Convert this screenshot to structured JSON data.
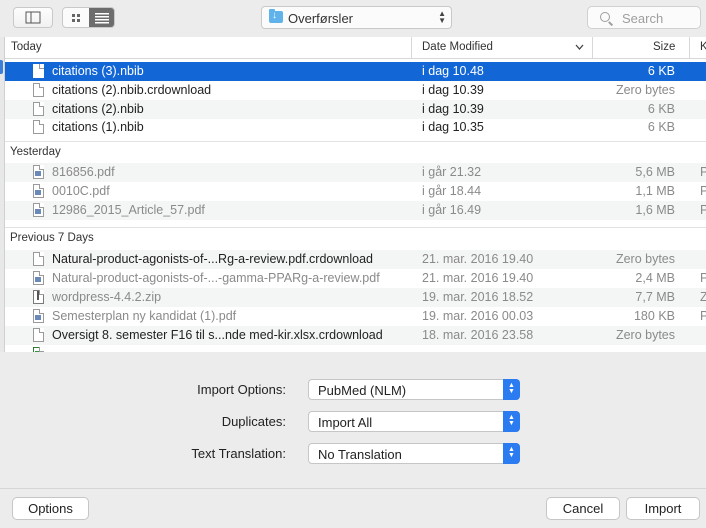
{
  "toolbar": {
    "location": "Overførsler",
    "search_placeholder": "Search"
  },
  "columns": {
    "name": "Today",
    "date": "Date Modified",
    "size": "Size",
    "kind": "K"
  },
  "groups": {
    "yesterday": "Yesterday",
    "previous": "Previous 7 Days"
  },
  "files": {
    "today": [
      {
        "name": "citations (3).nbib",
        "date": "i dag 10.48",
        "size": "6 KB"
      },
      {
        "name": "citations (2).nbib.crdownload",
        "date": "i dag 10.39",
        "size": "Zero bytes"
      },
      {
        "name": "citations (2).nbib",
        "date": "i dag 10.39",
        "size": "6 KB"
      },
      {
        "name": "citations (1).nbib",
        "date": "i dag 10.35",
        "size": "6 KB"
      }
    ],
    "yesterday": [
      {
        "name": "816856.pdf",
        "date": "i går 21.32",
        "size": "5,6 MB",
        "kind": "P"
      },
      {
        "name": "0010C.pdf",
        "date": "i går 18.44",
        "size": "1,1 MB",
        "kind": "P"
      },
      {
        "name": "12986_2015_Article_57.pdf",
        "date": "i går 16.49",
        "size": "1,6 MB",
        "kind": "P"
      }
    ],
    "previous": [
      {
        "name": "Natural-product-agonists-of-...Rg-a-review.pdf.crdownload",
        "date": "21. mar. 2016 19.40",
        "size": "Zero bytes"
      },
      {
        "name": "Natural-product-agonists-of-...-gamma-PPARg-a-review.pdf",
        "date": "21. mar. 2016 19.40",
        "size": "2,4 MB",
        "kind": "P"
      },
      {
        "name": "wordpress-4.4.2.zip",
        "date": "19. mar. 2016 18.52",
        "size": "7,7 MB",
        "kind": "Z"
      },
      {
        "name": "Semesterplan ny kandidat (1).pdf",
        "date": "19. mar. 2016 00.03",
        "size": "180 KB",
        "kind": "P"
      },
      {
        "name": "Oversigt 8. semester F16 til s...nde med-kir.xlsx.crdownload",
        "date": "18. mar. 2016 23.58",
        "size": "Zero bytes"
      }
    ]
  },
  "options": {
    "import_label": "Import Options:",
    "import_value": "PubMed (NLM)",
    "duplicates_label": "Duplicates:",
    "duplicates_value": "Import All",
    "translation_label": "Text Translation:",
    "translation_value": "No Translation"
  },
  "buttons": {
    "options": "Options",
    "cancel": "Cancel",
    "import": "Import"
  }
}
